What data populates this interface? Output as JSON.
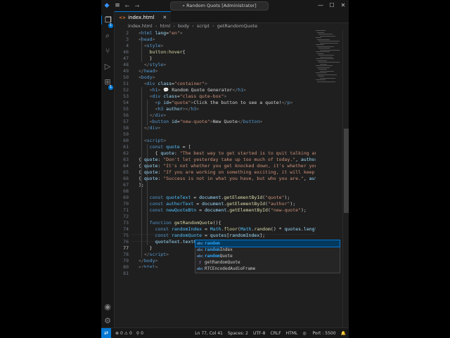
{
  "window": {
    "title": "Random Quots [Administrator]",
    "menu_icon": "≡",
    "controls": [
      "—",
      "☐",
      "✕"
    ]
  },
  "tab": {
    "filename": "index.html",
    "icon": "<>"
  },
  "breadcrumb": [
    "index.html",
    "html",
    "body",
    "script",
    "getRandomQuote"
  ],
  "line_numbers": [
    2,
    3,
    4,
    46,
    47,
    48,
    49,
    50,
    51,
    52,
    53,
    54,
    55,
    56,
    57,
    58,
    59,
    60,
    61,
    62,
    63,
    64,
    65,
    66,
    67,
    68,
    69,
    70,
    71,
    72,
    73,
    74,
    75,
    76,
    77,
    78,
    79,
    80,
    81
  ],
  "current_line": 77,
  "suggestions": {
    "items": [
      {
        "label": "random",
        "match": "random",
        "rest": "",
        "icon": "abc"
      },
      {
        "label": "randomIndex",
        "match": "random",
        "rest": "Index",
        "icon": "abc"
      },
      {
        "label": "randomQuote",
        "match": "random",
        "rest": "Quote",
        "icon": "abc"
      },
      {
        "label": "getRandomQuote",
        "match": "",
        "rest": "getRandomQuote",
        "icon": "ƒ"
      },
      {
        "label": "RTCEncodedAudioFrame",
        "match": "",
        "rest": "RTCEncodedAudioFrame",
        "icon": "abc"
      }
    ]
  },
  "status": {
    "errors": "0",
    "warnings": "0",
    "ports": "0",
    "position": "Ln 77, Col 41",
    "spaces": "Spaces: 2",
    "encoding": "UTF-8",
    "eol": "CRLF",
    "language": "HTML",
    "port": "Port : 5500"
  },
  "colors": {
    "accent": "#0078d4",
    "editor_bg": "#1f1f1f",
    "tag": "#569cd6",
    "attribute": "#9cdcfe",
    "string": "#ce9178",
    "keyword": "#c586c0",
    "function": "#dcdcaa"
  }
}
